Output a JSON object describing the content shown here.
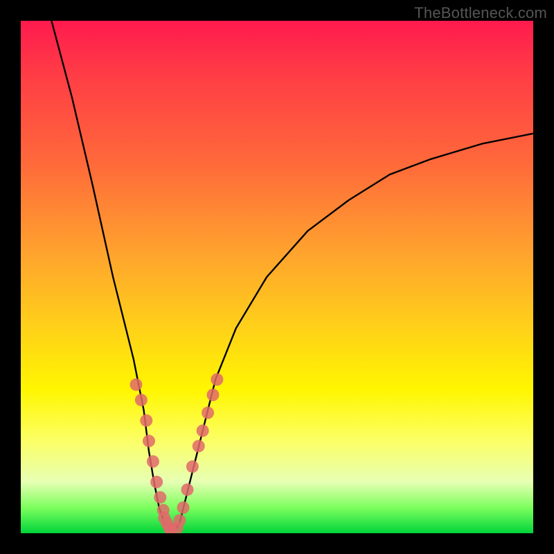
{
  "watermark": {
    "text": "TheBottleneck.com"
  },
  "chart_data": {
    "type": "line",
    "title": "",
    "xlabel": "",
    "ylabel": "",
    "xlim": [
      0,
      100
    ],
    "ylim": [
      0,
      100
    ],
    "grid": false,
    "legend": false,
    "series": [
      {
        "name": "bottleneck-curve",
        "x": [
          6,
          10,
          14,
          18,
          20,
          22,
          24,
          25,
          26,
          27,
          28,
          29,
          30,
          31,
          32,
          34,
          36,
          38,
          42,
          48,
          56,
          64,
          72,
          80,
          90,
          100
        ],
        "y": [
          100,
          85,
          68,
          50,
          42,
          34,
          24,
          16,
          10,
          5,
          2,
          0.5,
          0.5,
          2,
          6,
          14,
          22,
          30,
          40,
          50,
          59,
          65,
          70,
          73,
          76,
          78
        ]
      }
    ],
    "markers": [
      {
        "name": "left-cluster",
        "color": "#e06a6a",
        "x": [
          22.5,
          23.5,
          24.5,
          25.0,
          25.8,
          26.5,
          27.2,
          27.8,
          28.0,
          28.5,
          29.0,
          29.3
        ],
        "y": [
          29.0,
          26.0,
          22.0,
          18.0,
          14.0,
          10.0,
          7.0,
          4.5,
          3.0,
          2.0,
          1.0,
          0.8
        ]
      },
      {
        "name": "right-cluster",
        "color": "#e06a6a",
        "x": [
          30.5,
          31.0,
          31.7,
          32.5,
          33.5,
          34.7,
          35.5,
          36.5,
          37.5,
          38.3
        ],
        "y": [
          1.0,
          2.5,
          5.0,
          8.5,
          13.0,
          17.0,
          20.0,
          23.5,
          27.0,
          30.0
        ]
      }
    ],
    "background": {
      "type": "vertical-gradient",
      "stops": [
        {
          "pos": 0.0,
          "color": "#ff1a4d"
        },
        {
          "pos": 0.45,
          "color": "#ffa22e"
        },
        {
          "pos": 0.72,
          "color": "#fff600"
        },
        {
          "pos": 0.95,
          "color": "#7dff5e"
        },
        {
          "pos": 1.0,
          "color": "#00d43a"
        }
      ]
    }
  }
}
